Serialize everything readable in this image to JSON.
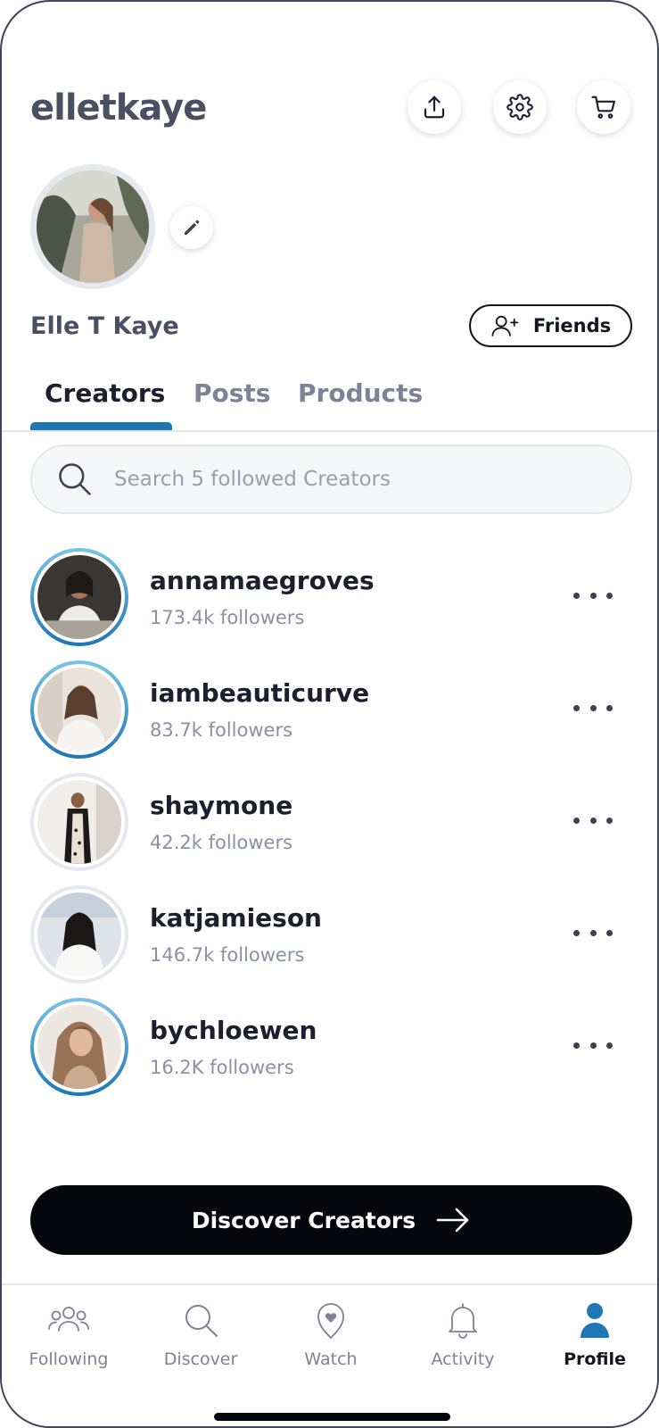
{
  "header": {
    "username": "elletkaye",
    "icons": [
      "share-icon",
      "gear-icon",
      "cart-icon"
    ]
  },
  "profile": {
    "full_name": "Elle T Kaye",
    "friends_label": "Friends"
  },
  "tabs": [
    {
      "label": "Creators",
      "active": true
    },
    {
      "label": "Posts",
      "active": false
    },
    {
      "label": "Products",
      "active": false
    }
  ],
  "search": {
    "placeholder": "Search 5 followed Creators",
    "value": ""
  },
  "creators": [
    {
      "name": "annamaegroves",
      "followers": "173.4k followers",
      "ring": "blue"
    },
    {
      "name": "iambeauticurve",
      "followers": "83.7k followers",
      "ring": "blue"
    },
    {
      "name": "shaymone",
      "followers": "42.2k followers",
      "ring": "gray"
    },
    {
      "name": "katjamieson",
      "followers": "146.7k followers",
      "ring": "gray"
    },
    {
      "name": "bychloewen",
      "followers": "16.2K followers",
      "ring": "blue"
    }
  ],
  "discover_button": {
    "label": "Discover Creators"
  },
  "bottom_nav": [
    {
      "label": "Following",
      "icon": "people-icon",
      "active": false
    },
    {
      "label": "Discover",
      "icon": "search-icon",
      "active": false
    },
    {
      "label": "Watch",
      "icon": "heart-pin-icon",
      "active": false
    },
    {
      "label": "Activity",
      "icon": "bell-icon",
      "active": false
    },
    {
      "label": "Profile",
      "icon": "person-icon",
      "active": true
    }
  ],
  "colors": {
    "accent": "#1e76b4",
    "primary_button": "#05070d",
    "muted_text": "#8b90a3"
  }
}
